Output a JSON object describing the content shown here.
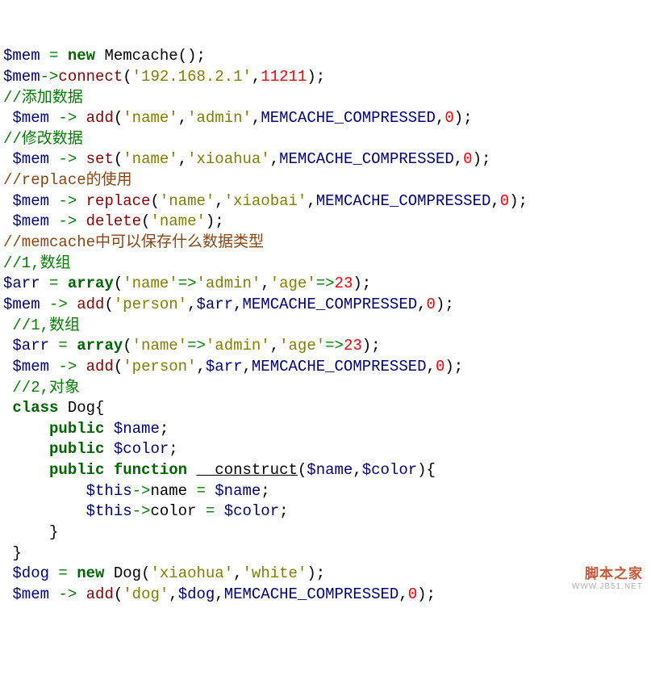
{
  "lines": {
    "l1": {
      "var1": "$mem",
      "op1": "=",
      "kw": "new",
      "cls": "Memcache",
      "open": "(",
      "close": ")",
      "semi": ";"
    },
    "l2": {
      "var1": "$mem",
      "arrow": "->",
      "fn": "connect",
      "open": "(",
      "s1": "'192.168.2.1'",
      "comma": ",",
      "n1": "11211",
      "close": ")",
      "semi": ";"
    },
    "l3": {
      "c": "//添加数据"
    },
    "l4": {
      "var1": "$mem",
      "arrow": "->",
      "fn": "add",
      "open": "(",
      "s1": "'name'",
      "c1": ",",
      "s2": "'admin'",
      "c2": ",",
      "con": "MEMCACHE_COMPRESSED",
      "c3": ",",
      "n1": "0",
      "close": ")",
      "semi": ";"
    },
    "l5": {
      "c": "//修改数据"
    },
    "l6": {
      "var1": "$mem",
      "arrow": "->",
      "fn": "set",
      "open": "(",
      "s1": "'name'",
      "c1": ",",
      "s2": "'xioahua'",
      "c2": ",",
      "con": "MEMCACHE_COMPRESSED",
      "c3": ",",
      "n1": "0",
      "close": ")",
      "semi": ";"
    },
    "l7": {
      "c": "//replace的使用"
    },
    "l8": {
      "var1": "$mem",
      "arrow": "->",
      "fn": "replace",
      "open": "(",
      "s1": "'name'",
      "c1": ",",
      "s2": "'xiaobai'",
      "c2": ",",
      "con": "MEMCACHE_COMPRESSED",
      "c3": ",",
      "n1": "0",
      "close": ")",
      "semi": ";"
    },
    "l9": {
      "var1": "$mem",
      "arrow": "->",
      "fn": "delete",
      "open": "(",
      "s1": "'name'",
      "close": ")",
      "semi": ";"
    },
    "l10": {
      "c": "//memcache中可以保存什么数据类型"
    },
    "l11": {
      "c": "//1,数组"
    },
    "l12": {
      "var1": "$arr",
      "op": "=",
      "kw": "array",
      "open": "(",
      "s1": "'name'",
      "a1": "=>",
      "s2": "'admin'",
      "c1": ",",
      "s3": "'age'",
      "a2": "=>",
      "n1": "23",
      "close": ")",
      "semi": ";"
    },
    "l13": {
      "var1": "$mem",
      "arrow": "->",
      "fn": "add",
      "open": "(",
      "s1": "'person'",
      "c1": ",",
      "var2": "$arr",
      "c2": ",",
      "con": "MEMCACHE_COMPRESSED",
      "c3": ",",
      "n1": "0",
      "close": ")",
      "semi": ";"
    },
    "l14": {
      "c": "//1,数组"
    },
    "l15": {
      "var1": "$arr",
      "op": "=",
      "kw": "array",
      "open": "(",
      "s1": "'name'",
      "a1": "=>",
      "s2": "'admin'",
      "c1": ",",
      "s3": "'age'",
      "a2": "=>",
      "n1": "23",
      "close": ")",
      "semi": ";"
    },
    "l16": {
      "var1": "$mem",
      "arrow": "->",
      "fn": "add",
      "open": "(",
      "s1": "'person'",
      "c1": ",",
      "var2": "$arr",
      "c2": ",",
      "con": "MEMCACHE_COMPRESSED",
      "c3": ",",
      "n1": "0",
      "close": ")",
      "semi": ";"
    },
    "l17": {
      "c": "//2,对象"
    },
    "l18": {
      "kw": "class",
      "cls": "Dog",
      "brace": "{"
    },
    "l19": {
      "kw": "public",
      "var1": "$name",
      "semi": ";"
    },
    "l20": {
      "kw": "public",
      "var1": "$color",
      "semi": ";"
    },
    "l21": {
      "kw1": "public",
      "kw2": "function",
      "fn": "__construct",
      "open": "(",
      "var1": "$name",
      "c1": ",",
      "var2": "$color",
      "close": ")",
      "brace": "{"
    },
    "l22": {
      "var1": "$this",
      "arrow": "->",
      "prop": "name",
      "op": "=",
      "var2": "$name",
      "semi": ";"
    },
    "l23": {
      "var1": "$this",
      "arrow": "->",
      "prop": "color",
      "op": "=",
      "var2": "$color",
      "semi": ";"
    },
    "l24": {
      "brace": "}"
    },
    "l25": {
      "brace": "}"
    },
    "l26": {
      "var1": "$dog",
      "op": "=",
      "kw": "new",
      "cls": "Dog",
      "open": "(",
      "s1": "'xiaohua'",
      "c1": ",",
      "s2": "'white'",
      "close": ")",
      "semi": ";"
    },
    "l27": {
      "var1": "$mem",
      "arrow": "->",
      "fn": "add",
      "open": "(",
      "s1": "'dog'",
      "c1": ",",
      "var2": "$dog",
      "c2": ",",
      "con": "MEMCACHE_COMPRESSED",
      "c3": ",",
      "n1": "0",
      "close": ")",
      "semi": ";"
    }
  },
  "watermark": {
    "l1": "脚本之家",
    "l2": "WWW.JB51.NET"
  }
}
